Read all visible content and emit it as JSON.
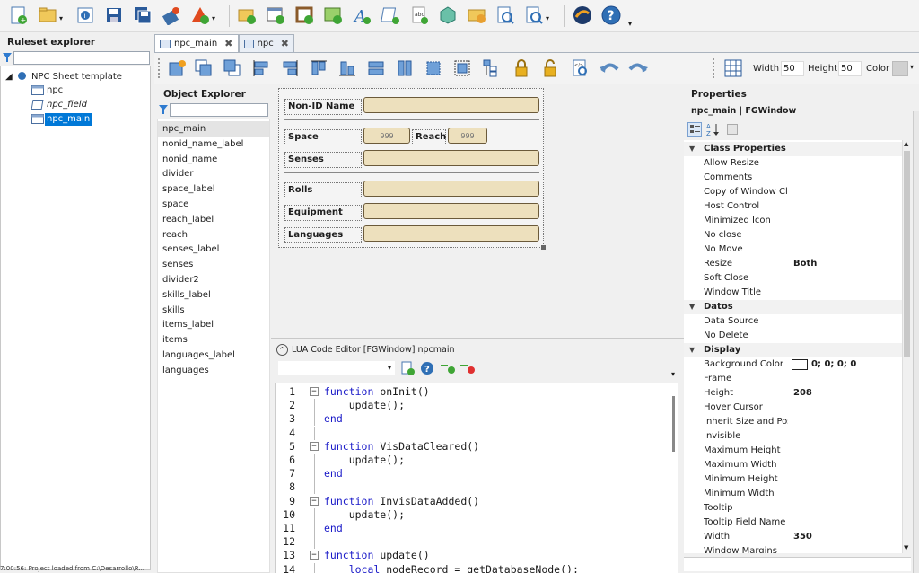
{
  "toolbar_main": {
    "icons": [
      "new-ruleset-icon",
      "open-ruleset-icon",
      "properties-icon",
      "save-icon",
      "save-all-icon",
      "build-icon",
      "deploy-icon",
      "add-folder-icon",
      "add-window-icon",
      "add-frame-icon",
      "add-image-icon",
      "add-font-icon",
      "add-script-icon",
      "add-string-icon",
      "add-dice-icon",
      "add-folder-open-icon",
      "search-icon",
      "find-document-icon",
      "fantasy-grounds-icon",
      "help-icon"
    ]
  },
  "ruleset_explorer": {
    "title": "Ruleset explorer",
    "root": "NPC Sheet template",
    "items": [
      "npc",
      "npc_field",
      "npc_main"
    ],
    "selected": "npc_main"
  },
  "tabs": [
    {
      "label": "npc_main",
      "active": true
    },
    {
      "label": "npc",
      "active": false
    }
  ],
  "design_toolbar": {
    "width_label": "Width",
    "width_value": "50",
    "height_label": "Height",
    "height_value": "50",
    "color_label": "Color"
  },
  "object_explorer": {
    "title": "Object Explorer",
    "items": [
      "npc_main",
      "nonid_name_label",
      "nonid_name",
      "divider",
      "space_label",
      "space",
      "reach_label",
      "reach",
      "senses_label",
      "senses",
      "divider2",
      "skills_label",
      "skills",
      "items_label",
      "items",
      "languages_label",
      "languages"
    ]
  },
  "design_canvas": {
    "nonid_label": "Non-ID Name",
    "space_label": "Space",
    "space_value": "999",
    "reach_label": "Reach",
    "reach_value": "999",
    "senses_label": "Senses",
    "rolls_label": "Rolls",
    "equipment_label": "Equipment",
    "languages_label": "Languages"
  },
  "lua_editor": {
    "title": "LUA Code Editor [FGWindow] npcmain",
    "lines": [
      {
        "n": "1",
        "kw": "function",
        "rest": " onInit()"
      },
      {
        "n": "2",
        "kw": "",
        "rest": "    update();"
      },
      {
        "n": "3",
        "kw": "end",
        "rest": ""
      },
      {
        "n": "4",
        "kw": "",
        "rest": ""
      },
      {
        "n": "5",
        "kw": "function",
        "rest": " VisDataCleared()"
      },
      {
        "n": "6",
        "kw": "",
        "rest": "    update();"
      },
      {
        "n": "7",
        "kw": "end",
        "rest": ""
      },
      {
        "n": "8",
        "kw": "",
        "rest": ""
      },
      {
        "n": "9",
        "kw": "function",
        "rest": " InvisDataAdded()"
      },
      {
        "n": "10",
        "kw": "",
        "rest": "    update();"
      },
      {
        "n": "11",
        "kw": "end",
        "rest": ""
      },
      {
        "n": "12",
        "kw": "",
        "rest": ""
      },
      {
        "n": "13",
        "kw": "function",
        "rest": " update()"
      },
      {
        "n": "14",
        "kw": "    local",
        "rest": " nodeRecord = getDatabaseNode();"
      }
    ]
  },
  "properties": {
    "title": "Properties",
    "subtitle": "npc_main | FGWindow",
    "categories": [
      {
        "name": "Class Properties",
        "rows": [
          {
            "name": "Allow Resize",
            "value": ""
          },
          {
            "name": "Comments",
            "value": ""
          },
          {
            "name": "Copy of Window Class",
            "value": ""
          },
          {
            "name": "Host Control",
            "value": ""
          },
          {
            "name": "Minimized Icon",
            "value": ""
          },
          {
            "name": "No close",
            "value": ""
          },
          {
            "name": "No Move",
            "value": ""
          },
          {
            "name": "Resize",
            "value": "Both"
          },
          {
            "name": "Soft Close",
            "value": ""
          },
          {
            "name": "Window Title",
            "value": ""
          }
        ]
      },
      {
        "name": "Datos",
        "rows": [
          {
            "name": "Data Source",
            "value": ""
          },
          {
            "name": "No Delete",
            "value": ""
          }
        ]
      },
      {
        "name": "Display",
        "rows": [
          {
            "name": "Background Color",
            "value": "0; 0; 0; 0"
          },
          {
            "name": "Frame",
            "value": ""
          },
          {
            "name": "Height",
            "value": "208"
          },
          {
            "name": "Hover Cursor",
            "value": ""
          },
          {
            "name": "Inherit Size and Position",
            "value": ""
          },
          {
            "name": "Invisible",
            "value": ""
          },
          {
            "name": "Maximum Height",
            "value": ""
          },
          {
            "name": "Maximum Width",
            "value": ""
          },
          {
            "name": "Minimum Height",
            "value": ""
          },
          {
            "name": "Minimum Width",
            "value": ""
          },
          {
            "name": "Tooltip",
            "value": ""
          },
          {
            "name": "Tooltip Field Name",
            "value": ""
          },
          {
            "name": "Width",
            "value": "350"
          },
          {
            "name": "Window Margins",
            "value": ""
          }
        ]
      }
    ]
  },
  "status_bar": {
    "text": "7:00:56: Project loaded from C:\\Desarrollo\\R..."
  },
  "colors": {
    "accent": "#0078d7",
    "field_fill": "#ede0bd",
    "field_border": "#6b5a3a",
    "keyword": "#1a1ac8"
  }
}
